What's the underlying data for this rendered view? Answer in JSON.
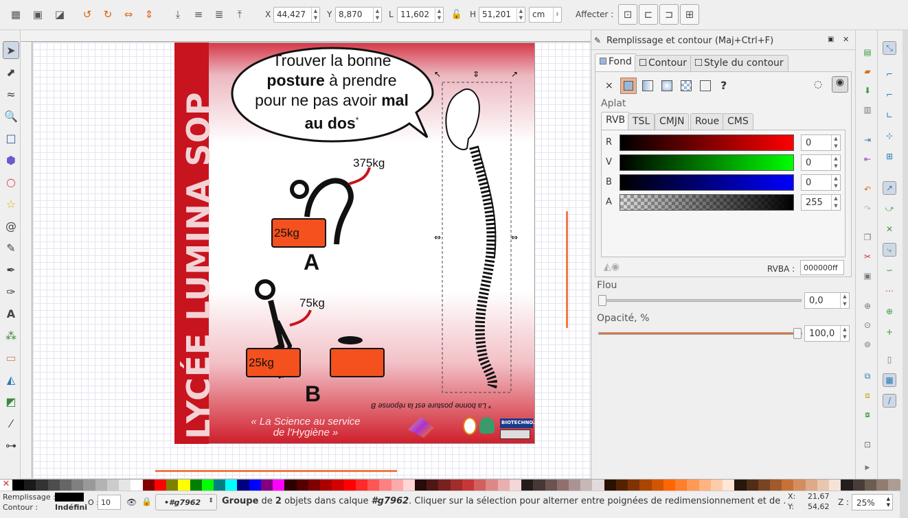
{
  "toolbar": {
    "x_label": "X",
    "x_value": "44,427",
    "y_label": "Y",
    "y_value": "8,870",
    "w_label": "L",
    "w_value": "11,602",
    "h_label": "H",
    "h_value": "51,201",
    "unit": "cm",
    "affect_label": "Affecter :"
  },
  "document": {
    "bubble_line1": "Trouver la bonne",
    "bubble_line2_bold": "posture",
    "bubble_line2_rest": " à prendre",
    "bubble_line3_start": "pour ne pas avoir ",
    "bubble_line3_bold": "mal",
    "bubble_line4_bold": "au dos",
    "bubble_star": "*",
    "weight_a_top": "375kg",
    "box_a": "25kg",
    "label_a": "A",
    "weight_b_top": "75kg",
    "box_b": "25kg",
    "label_b": "B",
    "footnote": "* La bonne posture est la réponse B",
    "band_text": "LYCÉE LUMINA SOP",
    "slogan_line1": "« La Science au service",
    "slogan_line2": "de l'Hygiène »",
    "logo_text": "BIOTECHNO.fr"
  },
  "panel": {
    "title": "Remplissage et contour (Maj+Ctrl+F)",
    "tabs": [
      "Fond",
      "Contour",
      "Style du contour"
    ],
    "flat_label": "Aplat",
    "color_tabs": [
      "RVB",
      "TSL",
      "CMJN",
      "Roue",
      "CMS"
    ],
    "channels": [
      {
        "label": "R",
        "value": "0"
      },
      {
        "label": "V",
        "value": "0"
      },
      {
        "label": "B",
        "value": "0"
      },
      {
        "label": "A",
        "value": "255"
      }
    ],
    "rgba_label": "RVBA :",
    "rgba_value": "000000ff",
    "blur_label": "Flou",
    "blur_value": "0,0",
    "opacity_label": "Opacité, %",
    "opacity_value": "100,0",
    "blur_level": 0,
    "opacity_level": 1.0
  },
  "status": {
    "fill_label": "Remplissage :",
    "stroke_label": "Contour :",
    "stroke_value": "Indéfini",
    "o_label": "O :",
    "o_value": "10",
    "layer": "•#g7962",
    "msg_b1": "Groupe",
    "msg_t1": " de ",
    "msg_b2": "2",
    "msg_t2": " objets dans calque ",
    "msg_b3": "#g7962",
    "msg_t3": ". Cliquer sur la sélection pour alterner entre poignées de redimensionnement et de .",
    "x_label": "X:",
    "x_value": "21,67",
    "y_label": "Y:",
    "y_value": "54,62",
    "z_label": "Z :",
    "zoom_value": "25%"
  },
  "colors": {
    "accent": "#f4511e",
    "band": "#c8141e",
    "palette": [
      "#000000",
      "#1a1a1a",
      "#333333",
      "#4d4d4d",
      "#666666",
      "#808080",
      "#999999",
      "#b3b3b3",
      "#cccccc",
      "#e6e6e6",
      "#ffffff",
      "#800000",
      "#ff0000",
      "#808000",
      "#ffff00",
      "#008000",
      "#00ff00",
      "#008080",
      "#00ffff",
      "#000080",
      "#0000ff",
      "#800080",
      "#ff00ff",
      "#2b0000",
      "#550000",
      "#800000",
      "#aa0000",
      "#d40000",
      "#ff0000",
      "#ff2a2a",
      "#ff5555",
      "#ff8080",
      "#ffaaaa",
      "#ffd5d5",
      "#280b0b",
      "#501616",
      "#782121",
      "#a02c2c",
      "#c83737",
      "#d35f5f",
      "#de8787",
      "#e9afaf",
      "#f4d7d7",
      "#241c1c",
      "#483737",
      "#6c5353",
      "#916f6f",
      "#ac9393",
      "#c8b7b7",
      "#e3dbdb",
      "#2b1100",
      "#552200",
      "#803300",
      "#aa4400",
      "#d45500",
      "#ff6600",
      "#ff7f2a",
      "#ff9955",
      "#ffb380",
      "#ffccaa",
      "#ffe6d5",
      "#28170b",
      "#502d16",
      "#784421",
      "#a05a2c",
      "#c87137",
      "#d38d5f",
      "#deaa87",
      "#e9c6af",
      "#f4e3d7",
      "#241f1c",
      "#483e37",
      "#6c5d53",
      "#917c6f",
      "#ac9d93"
    ]
  }
}
